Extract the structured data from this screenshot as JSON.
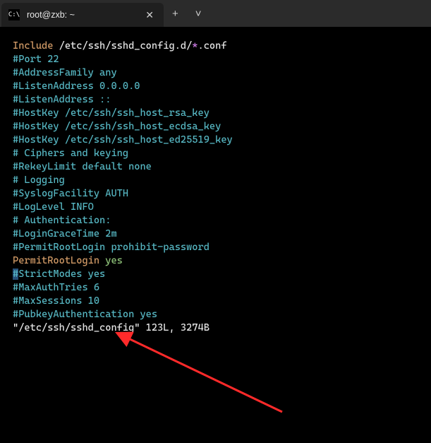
{
  "tab": {
    "title": "root@zxb: ~",
    "icon_glyph": "C:\\"
  },
  "titlebar": {
    "new_tab": "+",
    "dropdown": "˅",
    "close": "✕"
  },
  "lines": {
    "l1a": "Include",
    "l1b": " /etc/ssh/sshd_config.d/",
    "l1c": "*",
    "l1d": ".conf",
    "l2": "",
    "l3": "#Port 22",
    "l4": "#AddressFamily any",
    "l5": "#ListenAddress 0.0.0.0",
    "l6": "#ListenAddress ::",
    "l7": "",
    "l8": "#HostKey /etc/ssh/ssh_host_rsa_key",
    "l9": "#HostKey /etc/ssh/ssh_host_ecdsa_key",
    "l10": "#HostKey /etc/ssh/ssh_host_ed25519_key",
    "l11": "",
    "l12": "# Ciphers and keying",
    "l13": "#RekeyLimit default none",
    "l14": "",
    "l15": "# Logging",
    "l16": "#SyslogFacility AUTH",
    "l17": "#LogLevel INFO",
    "l18": "",
    "l19": "# Authentication:",
    "l20": "",
    "l21": "#LoginGraceTime 2m",
    "l22": "#PermitRootLogin prohibit-password",
    "l23a": "PermitRootLogin",
    "l23b": " ",
    "l23c": "yes",
    "l24a": "#",
    "l24b": "StrictModes yes",
    "l25": "#MaxAuthTries 6",
    "l26": "#MaxSessions 10",
    "l27": "",
    "l28": "#PubkeyAuthentication yes",
    "l29": "",
    "status": "\"/etc/ssh/sshd_config\" 123L, 3274B"
  }
}
